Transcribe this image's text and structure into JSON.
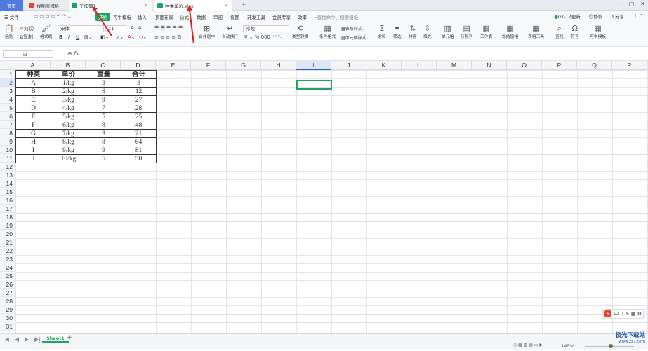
{
  "tabs": {
    "home": "首页",
    "t1": "找稻壳模板",
    "t2": "工作簿1",
    "t3": "种类单价.xlsx"
  },
  "menu": {
    "file": "文件",
    "start": "开始",
    "items": [
      "可牛模板",
      "插入",
      "页面布局",
      "公式",
      "数据",
      "审阅",
      "视图",
      "开发工具",
      "会员专享",
      "效率"
    ],
    "search": "查找命令、搜索模板",
    "update": "07-17更新",
    "collab": "协作",
    "share": "分享"
  },
  "toolbar": {
    "paste": "粘贴",
    "cut": "剪切",
    "copy": "复制",
    "painter": "格式刷",
    "font": "宋体",
    "size": "11",
    "format": "常规",
    "merge": "合并居中",
    "wrap": "自动换行",
    "typeconv": "类型转换",
    "cond": "条件格式",
    "tablestyle": "表格样式",
    "cellstyle": "单元格样式",
    "sum": "求和",
    "filter": "筛选",
    "sort": "排序",
    "fill": "填充",
    "cell": "单元格",
    "rowcol": "行和列",
    "sheet": "工作表",
    "freeze": "冻结窗格",
    "tools": "表格工具",
    "find": "查找",
    "symbol": "符号",
    "kn": "可牛模板"
  },
  "namebox": "I2",
  "fx": "fx",
  "columns": [
    "A",
    "B",
    "C",
    "D",
    "E",
    "F",
    "G",
    "H",
    "I",
    "J",
    "K",
    "L",
    "M",
    "N",
    "O",
    "P",
    "Q",
    "R"
  ],
  "rows": [
    "1",
    "2",
    "3",
    "4",
    "5",
    "6",
    "7",
    "8",
    "9",
    "10",
    "11",
    "12",
    "13",
    "14",
    "15",
    "16",
    "17",
    "18",
    "19",
    "20",
    "21",
    "22",
    "23",
    "24",
    "25",
    "26",
    "27",
    "28",
    "29",
    "30",
    "31"
  ],
  "table": {
    "header": [
      "种类",
      "单价",
      "重量",
      "合计"
    ],
    "data": [
      [
        "A",
        "1/kg",
        "3",
        "3"
      ],
      [
        "B",
        "2/kg",
        "6",
        "12"
      ],
      [
        "C",
        "3/kg",
        "9",
        "27"
      ],
      [
        "D",
        "4/kg",
        "7",
        "28"
      ],
      [
        "E",
        "5/kg",
        "5",
        "25"
      ],
      [
        "F",
        "6/kg",
        "8",
        "48"
      ],
      [
        "G",
        "7/kg",
        "3",
        "21"
      ],
      [
        "H",
        "8/kg",
        "8",
        "64"
      ],
      [
        "I",
        "9/kg",
        "9",
        "81"
      ],
      [
        "J",
        "10/kg",
        "5",
        "50"
      ]
    ]
  },
  "sheet": "Sheet1",
  "zoom": "145%",
  "ime": "中",
  "watermark": "极光下载站",
  "watermark_url": "www.xz7.com",
  "accent": "#1fa360"
}
